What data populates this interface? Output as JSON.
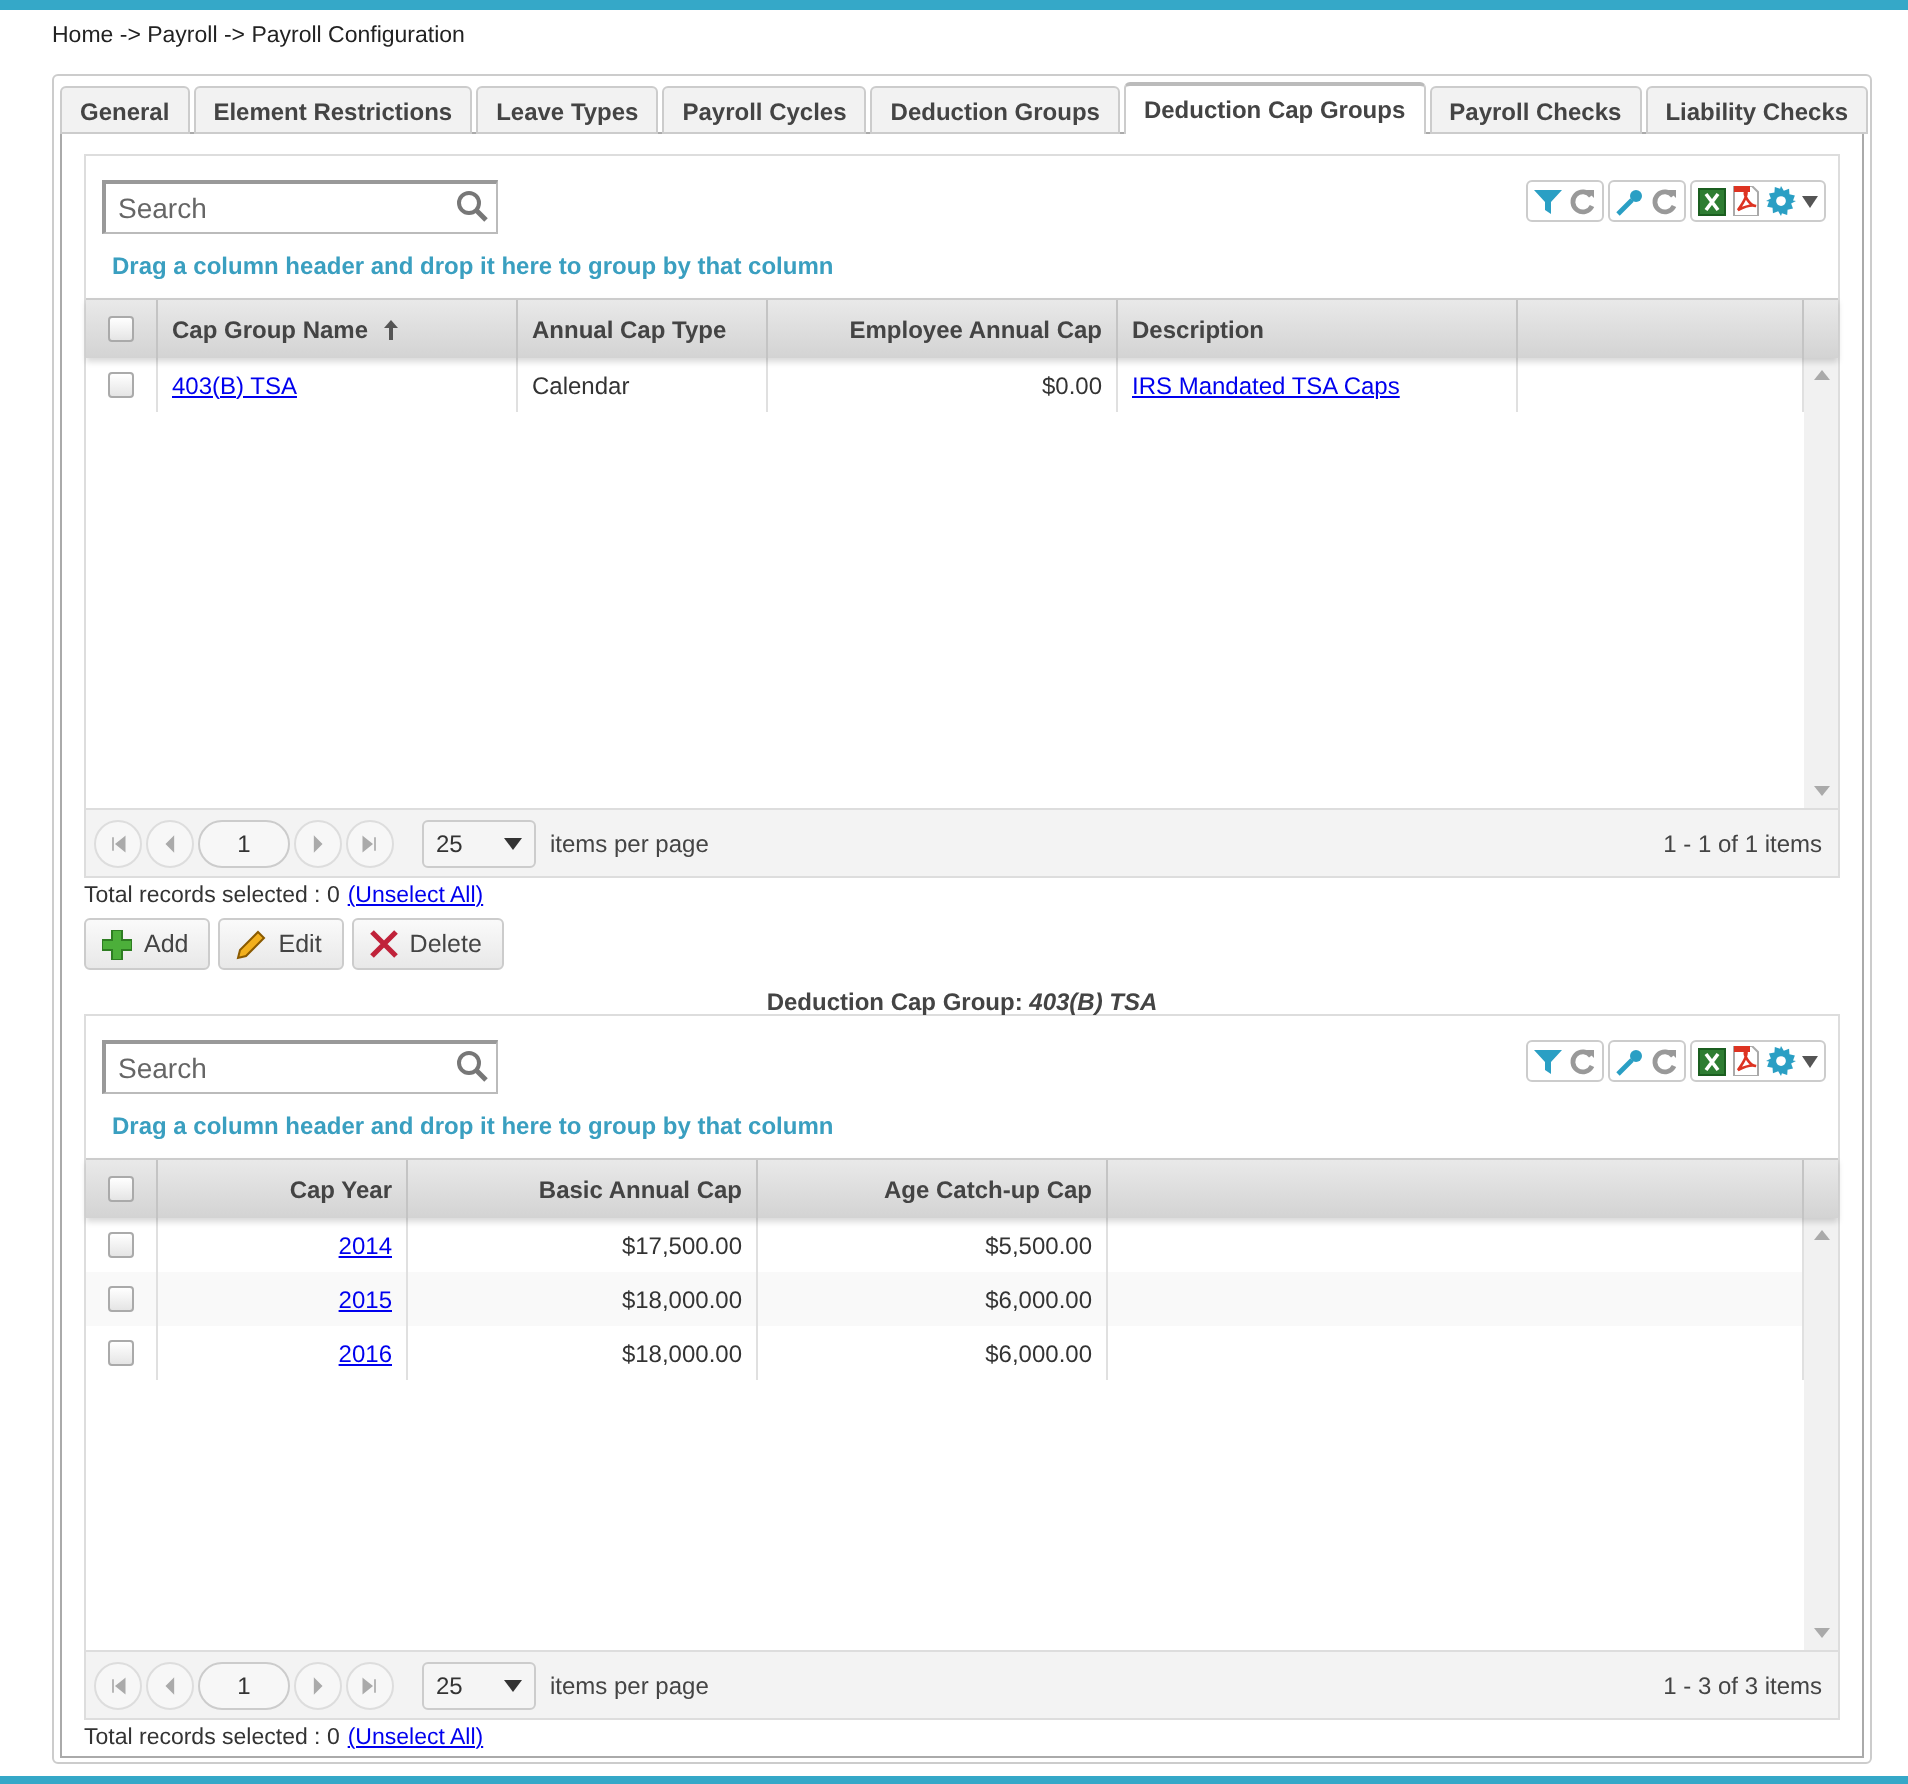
{
  "breadcrumb": "Home -> Payroll -> Payroll Configuration",
  "tabs": [
    {
      "label": "General",
      "selected": false
    },
    {
      "label": "Element Restrictions",
      "selected": false
    },
    {
      "label": "Leave Types",
      "selected": false
    },
    {
      "label": "Payroll Cycles",
      "selected": false
    },
    {
      "label": "Deduction Groups",
      "selected": false
    },
    {
      "label": "Deduction Cap Groups",
      "selected": true
    },
    {
      "label": "Payroll Checks",
      "selected": false
    },
    {
      "label": "Liability Checks",
      "selected": false
    }
  ],
  "grids": [
    {
      "search": {
        "placeholder": "Search"
      },
      "group_hint": "Drag a column header and drop it here to group by that column",
      "all_selected": false,
      "columns": [
        {
          "label": "Cap Group Name",
          "kind": "link",
          "sorted": true
        },
        {
          "label": "Annual Cap Type",
          "kind": "text",
          "sorted": false
        },
        {
          "label": "Employee Annual Cap",
          "kind": "text",
          "sorted": false
        },
        {
          "label": "Description",
          "kind": "link",
          "sorted": false
        }
      ],
      "rows": [
        {
          "checked": false,
          "cells": [
            "403(B) TSA",
            "Calendar",
            "$0.00",
            "IRS Mandated TSA Caps"
          ]
        }
      ],
      "pager": {
        "page": "1",
        "page_size": "25",
        "per_page_label": "items per page",
        "summary": "1 - 1 of 1 items"
      },
      "selection": {
        "text": "Total records selected : 0",
        "link": "(Unselect All)"
      }
    },
    {
      "search": {
        "placeholder": "Search"
      },
      "group_hint": "Drag a column header and drop it here to group by that column",
      "all_selected": false,
      "columns": [
        {
          "label": "Cap Year",
          "kind": "link",
          "sorted": false
        },
        {
          "label": "Basic Annual Cap",
          "kind": "text",
          "sorted": false
        },
        {
          "label": "Age Catch-up Cap",
          "kind": "text",
          "sorted": false
        }
      ],
      "rows": [
        {
          "checked": false,
          "cells": [
            "2014",
            "$17,500.00",
            "$5,500.00"
          ]
        },
        {
          "checked": false,
          "cells": [
            "2015",
            "$18,000.00",
            "$6,000.00"
          ]
        },
        {
          "checked": false,
          "cells": [
            "2016",
            "$18,000.00",
            "$6,000.00"
          ]
        }
      ],
      "pager": {
        "page": "1",
        "page_size": "25",
        "per_page_label": "items per page",
        "summary": "1 - 3 of 3 items"
      },
      "selection": {
        "text": "Total records selected : 0",
        "link": "(Unselect All)"
      }
    }
  ],
  "actions": [
    {
      "label": "Add",
      "kind": "add"
    },
    {
      "label": "Edit",
      "kind": "edit"
    },
    {
      "label": "Delete",
      "kind": "delete"
    }
  ],
  "detail_title": "Deduction Cap Group: *403(B) TSA*"
}
